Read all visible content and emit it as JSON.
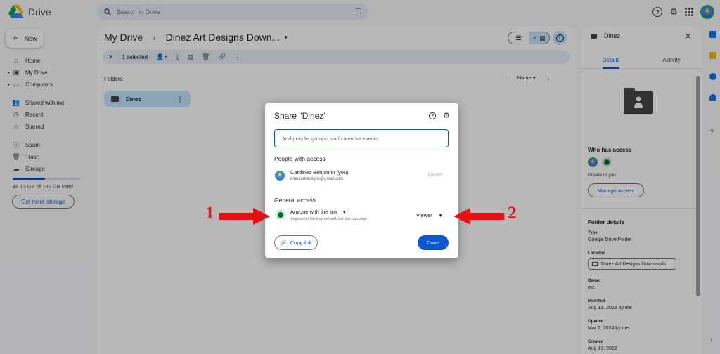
{
  "app": {
    "name": "Drive"
  },
  "search": {
    "placeholder": "Search in Drive"
  },
  "sidebar": {
    "new_label": "New",
    "items": [
      {
        "label": "Home",
        "icon": "home-icon"
      },
      {
        "label": "My Drive",
        "icon": "drive-icon"
      },
      {
        "label": "Computers",
        "icon": "computer-icon"
      },
      {
        "label": "Shared with me",
        "icon": "people-icon"
      },
      {
        "label": "Recent",
        "icon": "clock-icon"
      },
      {
        "label": "Starred",
        "icon": "star-icon"
      },
      {
        "label": "Spam",
        "icon": "spam-icon"
      },
      {
        "label": "Trash",
        "icon": "trash-icon"
      },
      {
        "label": "Storage",
        "icon": "cloud-icon"
      }
    ],
    "storage_used_fraction": 0.4813,
    "storage_text": "48.13 GB of 100 GB used",
    "get_storage_label": "Get more storage"
  },
  "main": {
    "breadcrumb_root": "My Drive",
    "breadcrumb_current": "Dinez Art Designs Down...",
    "selection_text": "1 selected",
    "folders_heading": "Folders",
    "sort_label": "Name",
    "folder_name": "Dinez"
  },
  "details": {
    "title": "Dinez",
    "tab_details": "Details",
    "tab_activity": "Activity",
    "who_has_access": "Who has access",
    "private_text": "Private to you",
    "manage_access": "Manage access",
    "folder_details": "Folder details",
    "type_label": "Type",
    "type_value": "Google Drive Folder",
    "location_label": "Location",
    "location_value": "Dinez Art Designs Downloads",
    "owner_label": "Owner",
    "owner_value": "me",
    "modified_label": "Modified",
    "modified_value": "Aug 13, 2022 by me",
    "opened_label": "Opened",
    "opened_value": "Mar 2, 2024 by me",
    "created_label": "Created",
    "created_value": "Aug 13, 2022"
  },
  "modal": {
    "title": "Share \"Dinez\"",
    "input_placeholder": "Add people, groups, and calendar events",
    "people_heading": "People with access",
    "person_name": "Cardinez Benjamin (you)",
    "person_email": "dinezartdesigns@gmail.com",
    "person_role": "Owner",
    "general_heading": "General access",
    "access_option": "Anyone with the link",
    "access_sub": "Anyone on the internet with the link can view",
    "role_option": "Viewer",
    "copy_link": "Copy link",
    "done": "Done"
  },
  "annotations": {
    "left_number": "1",
    "right_number": "2",
    "arrow_color": "#e8110f"
  },
  "colors": {
    "accent": "#0b57d0",
    "selected": "#c2e7ff"
  }
}
